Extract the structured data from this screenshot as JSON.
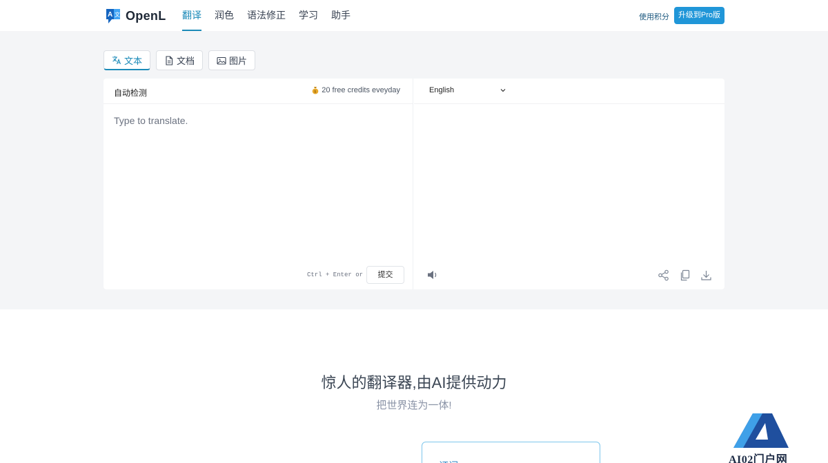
{
  "header": {
    "brand": "OpenL",
    "nav": [
      {
        "label": "翻译",
        "active": true
      },
      {
        "label": "润色",
        "active": false
      },
      {
        "label": "语法修正",
        "active": false
      },
      {
        "label": "学习",
        "active": false
      },
      {
        "label": "助手",
        "active": false
      }
    ],
    "use_credits": "使用积分",
    "upgrade": "升级到Pro版"
  },
  "tabs": [
    {
      "label": "文本",
      "icon": "translate-icon",
      "active": true
    },
    {
      "label": "文档",
      "icon": "document-icon",
      "active": false
    },
    {
      "label": "图片",
      "icon": "image-icon",
      "active": false
    }
  ],
  "source": {
    "language": "自动检测",
    "credits_note": "20 free credits eveyday",
    "placeholder": "Type to translate.",
    "shortcut": "Ctrl + Enter or",
    "submit": "提交"
  },
  "target": {
    "language": "English"
  },
  "hero": {
    "title": "惊人的翻译器,由AI提供动力",
    "subtitle": "把世界连为一体!"
  },
  "feature_card": {
    "label": "证词"
  },
  "watermark": {
    "text": "AI02门户网"
  },
  "colors": {
    "accent": "#1b8ab8",
    "button": "#2096d8",
    "band": "#f4f5f7"
  }
}
